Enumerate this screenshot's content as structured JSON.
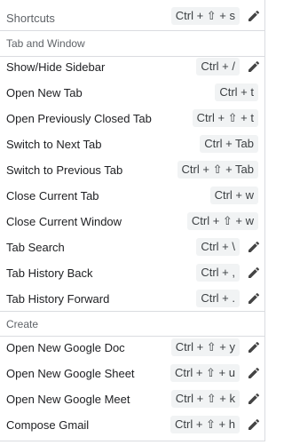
{
  "header": {
    "title": "Shortcuts",
    "keys": "Ctrl + ⇧ + s"
  },
  "sections": {
    "tab_window": "Tab and Window",
    "create": "Create"
  },
  "rows": [
    {
      "label": "Show/Hide Sidebar",
      "keys": "Ctrl + /"
    },
    {
      "label": "Open New Tab",
      "keys": "Ctrl + t"
    },
    {
      "label": "Open Previously Closed Tab",
      "keys": "Ctrl + ⇧ + t"
    },
    {
      "label": "Switch to Next Tab",
      "keys": "Ctrl + Tab"
    },
    {
      "label": "Switch to Previous Tab",
      "keys": "Ctrl + ⇧ + Tab"
    },
    {
      "label": "Close Current Tab",
      "keys": "Ctrl + w"
    },
    {
      "label": "Close Current Window",
      "keys": "Ctrl + ⇧ + w"
    },
    {
      "label": "Tab Search",
      "keys": "Ctrl + \\"
    },
    {
      "label": "Tab History Back",
      "keys": "Ctrl + ,"
    },
    {
      "label": "Tab History Forward",
      "keys": "Ctrl + ."
    }
  ],
  "create_rows": [
    {
      "label": "Open New Google Doc",
      "keys": "Ctrl + ⇧ + y"
    },
    {
      "label": "Open New Google Sheet",
      "keys": "Ctrl + ⇧ + u"
    },
    {
      "label": "Open New Google Meet",
      "keys": "Ctrl + ⇧ + k"
    },
    {
      "label": "Compose Gmail",
      "keys": "Ctrl + ⇧ + h"
    }
  ]
}
